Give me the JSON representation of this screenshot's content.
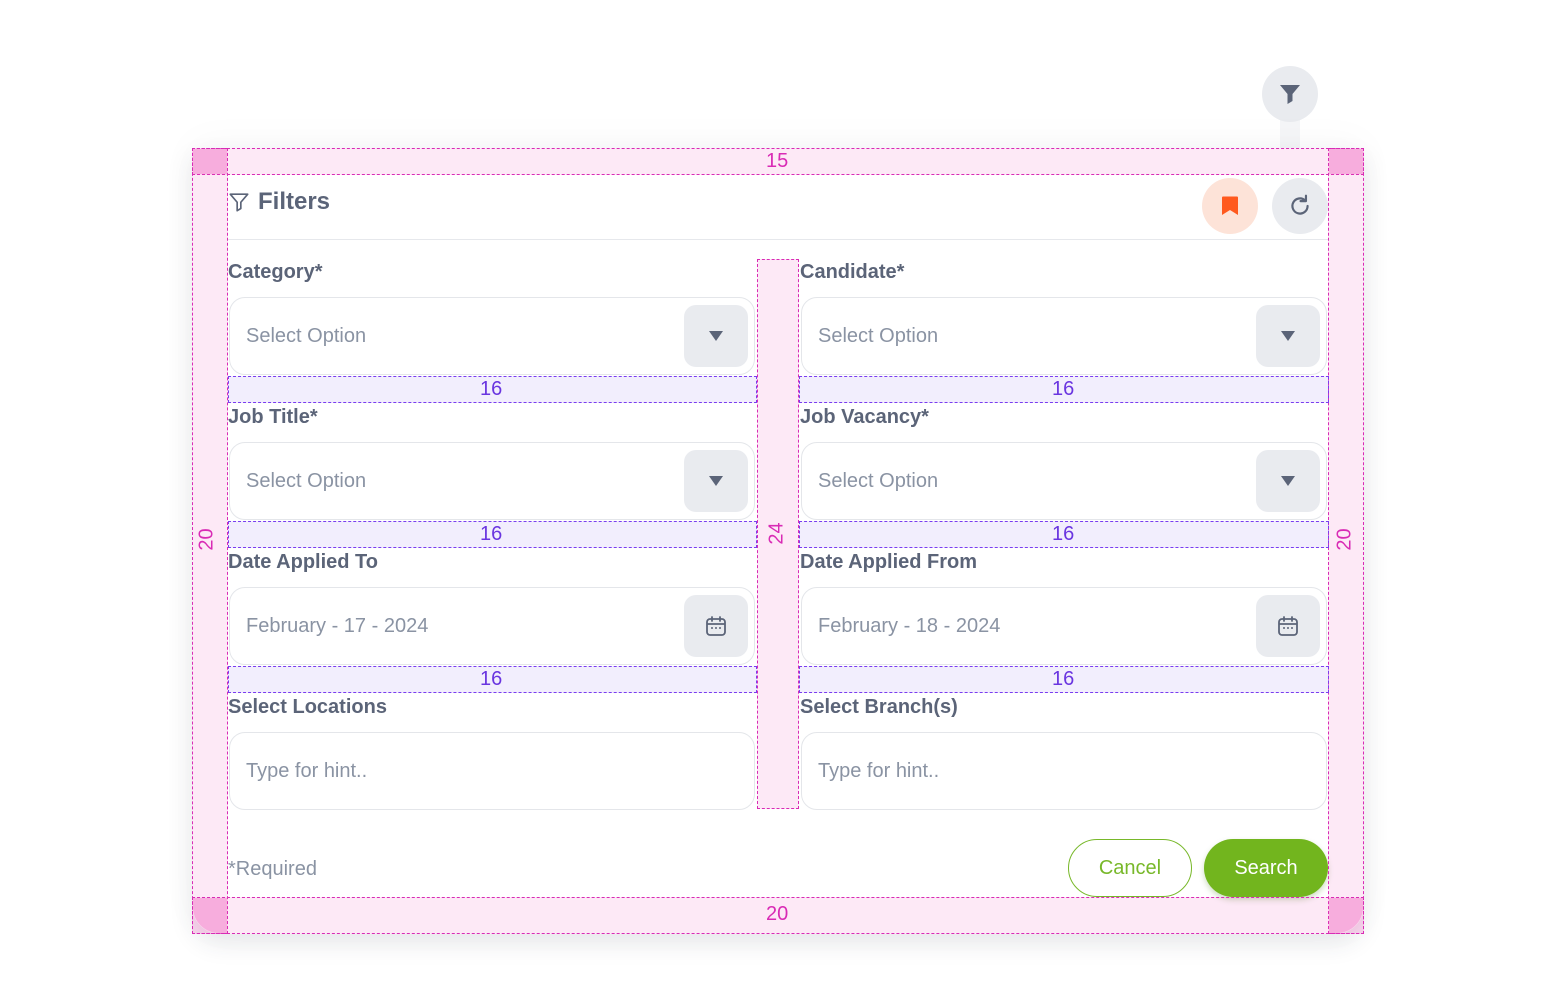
{
  "toggle": {
    "icon": "funnel-filled-icon"
  },
  "header": {
    "title": "Filters",
    "title_icon": "funnel-outline-icon",
    "bookmark_icon": "bookmark-icon",
    "reset_icon": "refresh-icon",
    "colors": {
      "bookmark_bg": "#fde3d8",
      "bookmark_fg": "#ff5a1f"
    }
  },
  "fields": {
    "category": {
      "label": "Category*",
      "value": "Select Option",
      "icon": "caret-down-icon"
    },
    "candidate": {
      "label": "Candidate*",
      "value": "Select Option",
      "icon": "caret-down-icon"
    },
    "job_title": {
      "label": "Job Title*",
      "value": "Select Option",
      "icon": "caret-down-icon"
    },
    "job_vacancy": {
      "label": "Job Vacancy*",
      "value": "Select Option",
      "icon": "caret-down-icon"
    },
    "date_to": {
      "label": "Date Applied To",
      "value": "February - 17 - 2024",
      "icon": "calendar-icon"
    },
    "date_from": {
      "label": "Date Applied From",
      "value": "February - 18 - 2024",
      "icon": "calendar-icon"
    },
    "locations": {
      "label": "Select Locations",
      "placeholder": "Type for hint.."
    },
    "branches": {
      "label": "Select Branch(s)",
      "placeholder": "Type for hint.."
    }
  },
  "footer": {
    "required_note": "*Required",
    "cancel_label": "Cancel",
    "search_label": "Search",
    "accent": "#72b51e"
  },
  "spacing_annotations": {
    "top": "15",
    "left": "20",
    "right": "20",
    "bottom": "20",
    "column_gap": "24",
    "row_gaps": [
      "16",
      "16",
      "16",
      "16",
      "16",
      "16"
    ]
  }
}
